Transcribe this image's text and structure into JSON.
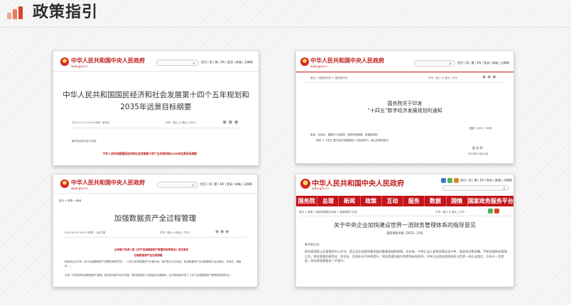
{
  "page": {
    "title": "政策指引"
  },
  "gov": {
    "site_name": "中华人民共和国中央人民政府",
    "site_url": "www.gov.cn",
    "search_icon": "search-icon",
    "top_links": "首页 | 简 | 繁 | EN | 登录 | 邮箱 | 无障碍"
  },
  "cards": [
    {
      "title_line1": "中华人民共和国国民经济和社会发展第十四个五年规划和",
      "title_line2": "2035年远景目标纲要",
      "meta_left": "2021-03-13 09:18   来源：新华社",
      "meta_right": "字号：默认 大 超大  |  打印  |",
      "body_line": "新华社北京3月12日电",
      "red_line": "中华人民共和国国民经济和社会发展第十四个五年规划和2035年远景目标纲要"
    },
    {
      "crumb": "首页 > 国务院文件 > 国务院文件",
      "meta_right": "字号：默认 大 超大  |  打印",
      "title_line1": "国务院关于印发",
      "title_line2": "“十四五”数字经济发展规划的通知",
      "doc_no": "国发〔2021〕29号",
      "addressee": "各省、自治区、直辖市人民政府，国务院各部委、各直属机构：",
      "body_line": "现将《“十四五”数字经济发展规划》印发给你们，请认真贯彻执行。",
      "sign": "国  务  院",
      "date": "2021年12月12日"
    },
    {
      "crumb": "首页 > 政策 > 解读",
      "title": "加强数据资产全过程管理",
      "meta_left": "2024-04-03 09:10   来源：人民日报",
      "meta_right": "字号：默认 大 超大  |  打印  |",
      "red_line1": "业务部门负责人就《关于加强数据资产管理的指导意见》答记者问",
      "red_line2": "加强数据资产全过程管理",
      "para1": "财政部近日印发《关于加强数据资产管理的指导意见》，以充分发挥数据资产价值作用，保护各方合法权益，推进数据资产全过程管理以及合规化、标准化、增值化……",
      "para2": "为进一步规范和加强数据资产管理，更好推动数字经济发展，推动数据资产合规高效流通使用，近日财政部印发了《关于加强数据资产管理的指导意见》。"
    },
    {
      "nav": [
        "国务院",
        "总理",
        "新闻",
        "政策",
        "互动",
        "服务",
        "数据",
        "国情",
        "国家政务服务平台"
      ],
      "crumb": "首页 > 政策 > 国务院政策文件库 > 国务院部门文件",
      "meta_right": "字号：默认 大 超大  |  打印",
      "title": "关于中央企业加快建设世界一流财务管理体系的指导意见",
      "doc_no": "国资发财评规〔2022〕23号",
      "addressee": "各中央企业：",
      "para": "财务管理是企业管理的中心环节，是企业实现高质量发展的重要基础和保障。近年来，中央企业认真贯彻落实党中央、国务院决策部署，不断加强财务管理工作，财务管理的规范化、科学化、信息化水平持续提升，财务管理功能作用得到有效发挥。中央企业财务管理体系与世界一流企业相比，仍存在一定差距，财务管理需要进一步提升。"
    }
  ]
}
